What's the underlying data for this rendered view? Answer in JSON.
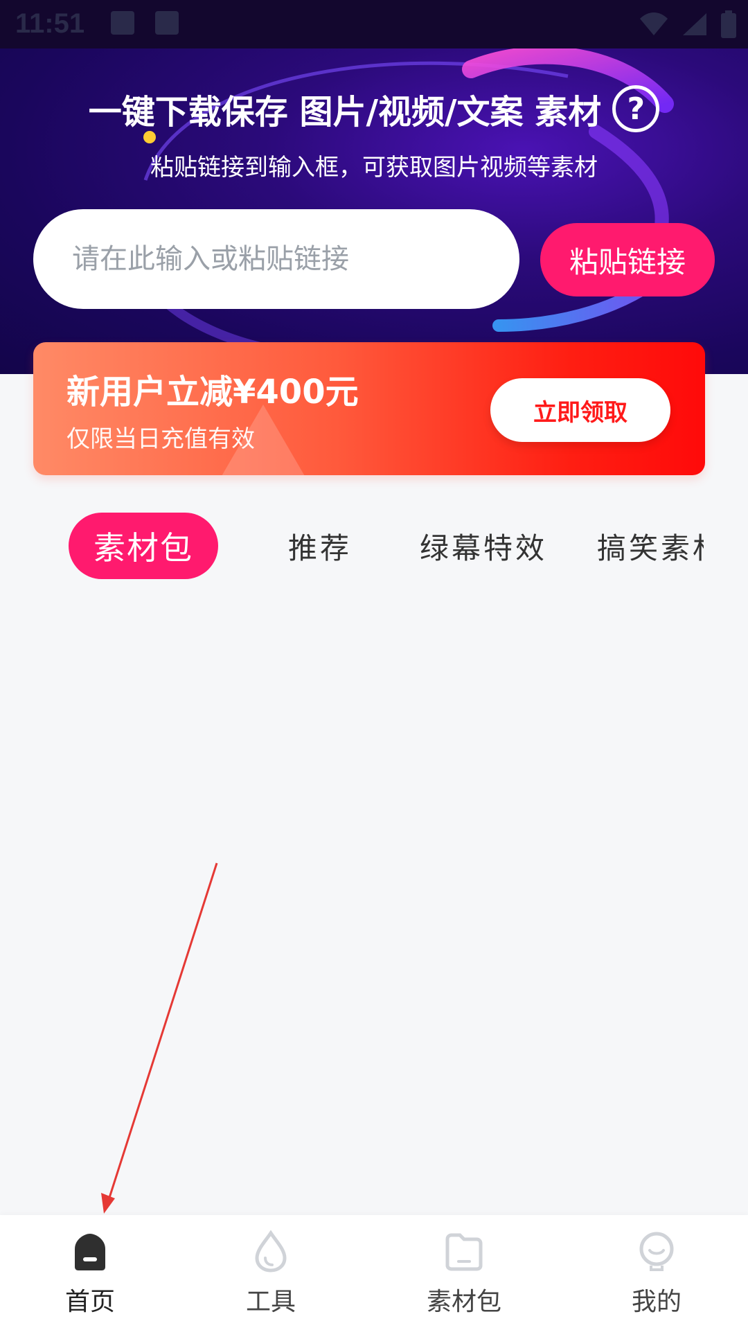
{
  "status_bar": {
    "time": "11:51"
  },
  "header": {
    "title": "一键下载保存 图片/视频/文案 素材",
    "help_icon_glyph": "?",
    "subtitle": "粘贴链接到输入框，可获取图片视频等素材",
    "input_placeholder": "请在此输入或粘贴链接",
    "paste_button_label": "粘贴链接"
  },
  "promo": {
    "title": "新用户立减¥400元",
    "subtitle": "仅限当日充值有效",
    "button_label": "立即领取"
  },
  "tabs": [
    {
      "label": "素材包",
      "active": true
    },
    {
      "label": "推荐",
      "active": false
    },
    {
      "label": "绿幕特效",
      "active": false
    },
    {
      "label": "搞笑素材",
      "active": false
    }
  ],
  "bottom_nav": [
    {
      "label": "首页",
      "icon": "home-icon",
      "active": true
    },
    {
      "label": "工具",
      "icon": "drop-icon",
      "active": false
    },
    {
      "label": "素材包",
      "icon": "folder-icon",
      "active": false
    },
    {
      "label": "我的",
      "icon": "profile-icon",
      "active": false
    }
  ],
  "colors": {
    "accent": "#ff1a6e",
    "header_dark": "#1a065c",
    "promo_start": "#ff8a66",
    "promo_end": "#ff0a0a",
    "annotation_arrow": "#e53935"
  }
}
